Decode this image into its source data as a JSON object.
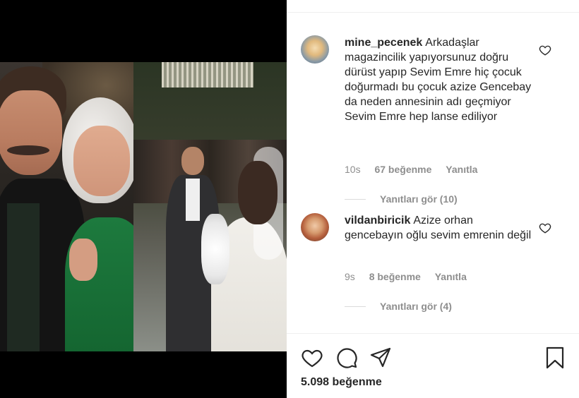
{
  "comments": [
    {
      "username": "mine_pecenek",
      "text": "Arkadaşlar magazincilik yapıyorsunuz doğru dürüst yapıp Sevim Emre hiç çocuk doğurmadı bu çocuk azize Gencebay da neden annesinin adı geçmiyor Sevim Emre hep lanse ediliyor",
      "time": "10s",
      "likes": "67 beğenme",
      "reply_label": "Yanıtla",
      "view_replies": "Yanıtları gör (10)"
    },
    {
      "username": "vildanbiricik",
      "text": "Azize orhan gencebayın oğlu sevim emrenin değil",
      "time": "9s",
      "likes": "8 beğenme",
      "reply_label": "Yanıtla",
      "view_replies": "Yanıtları gör (4)"
    }
  ],
  "post": {
    "like_count": "5.098 beğenme"
  },
  "icons": {
    "comment_like": "heart-outline-icon",
    "like": "heart-icon",
    "comment": "comment-bubble-icon",
    "share": "paper-plane-icon",
    "save": "bookmark-icon"
  },
  "colors": {
    "text": "#262626",
    "secondary_text": "#8e8e8e",
    "divider": "#efefef"
  }
}
